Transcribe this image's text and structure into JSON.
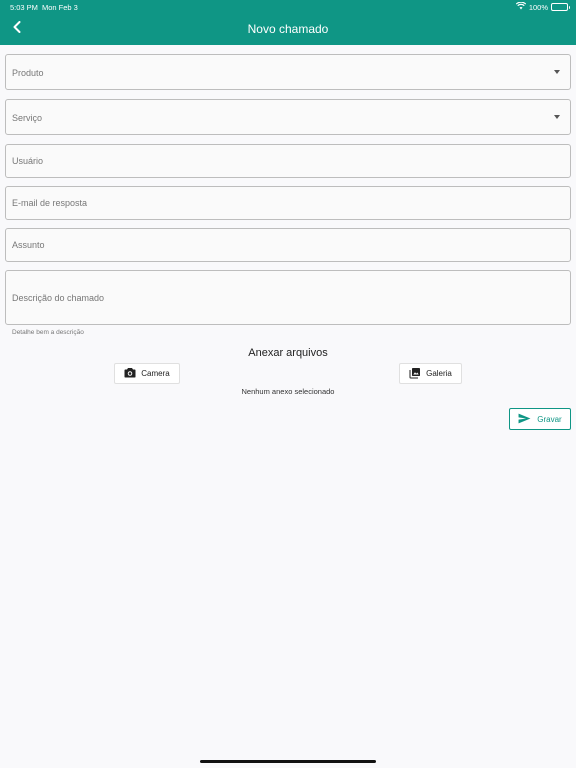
{
  "status_bar": {
    "time": "5:03 PM",
    "date": "Mon Feb 3",
    "battery": "100%",
    "wifi_icon": "wifi-icon",
    "battery_icon": "battery-icon"
  },
  "header": {
    "title": "Novo chamado",
    "back_icon": "chevron-left-icon",
    "color": "#0f9685"
  },
  "form": {
    "produto": {
      "label": "Produto"
    },
    "servico": {
      "label": "Serviço"
    },
    "usuario": {
      "label": "Usuário"
    },
    "email": {
      "label": "E-mail de resposta"
    },
    "assunto": {
      "label": "Assunto"
    },
    "descricao": {
      "label": "Descrição do chamado",
      "helper": "Detalhe bem a descrição"
    }
  },
  "attachments": {
    "title": "Anexar arquivos",
    "camera_label": "Camera",
    "camera_icon": "camera-icon",
    "gallery_label": "Galeria",
    "gallery_icon": "photo-library-icon",
    "empty_message": "Nenhum anexo selecionado"
  },
  "actions": {
    "save_label": "Gravar",
    "save_icon": "send-icon"
  }
}
